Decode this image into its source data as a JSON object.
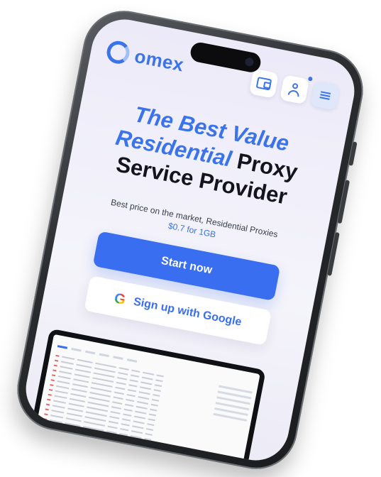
{
  "header": {
    "logo_text": "omex",
    "icons": [
      "wallet-icon",
      "user-icon",
      "menu-icon"
    ]
  },
  "hero": {
    "title_blue_1": "The Best Value",
    "title_blue_2": "Residential",
    "title_dark_1": "Proxy",
    "title_dark_2": "Service Provider"
  },
  "subtitle": {
    "text": "Best price on the market, Residential Proxies",
    "price": "$0.7 for 1GB"
  },
  "buttons": {
    "start": "Start now",
    "google": "Sign up with Google"
  },
  "colors": {
    "accent": "#3a73ea",
    "button_blue": "#3a6ef0",
    "dark_text": "#14141c"
  }
}
